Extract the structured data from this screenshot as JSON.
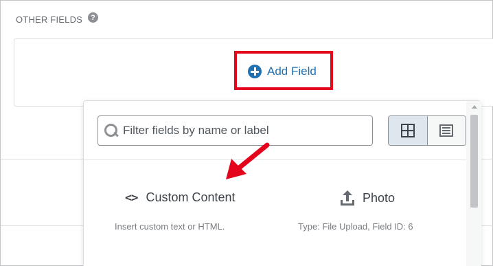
{
  "section": {
    "title": "OTHER FIELDS",
    "help_icon": "question-circle-icon"
  },
  "add_field": {
    "label": "Add Field",
    "icon": "plus-circle-icon",
    "highlight_color": "#e4041c"
  },
  "dropdown": {
    "search": {
      "placeholder": "Filter fields by name or label",
      "value": ""
    },
    "view_toggle": [
      {
        "name": "grid-view",
        "icon": "grid-icon",
        "active": true
      },
      {
        "name": "list-view",
        "icon": "list-icon",
        "active": false
      }
    ],
    "fields": [
      {
        "label": "Custom Content",
        "icon": "code-icon",
        "description": "Insert custom text or HTML."
      },
      {
        "label": "Photo",
        "icon": "upload-icon",
        "description": "Type: File Upload, Field ID: 6"
      }
    ]
  },
  "annotation": {
    "arrow_color": "#e4041c"
  },
  "colors": {
    "link": "#2271b1",
    "border": "#dcdcde",
    "text": "#3c434a"
  }
}
